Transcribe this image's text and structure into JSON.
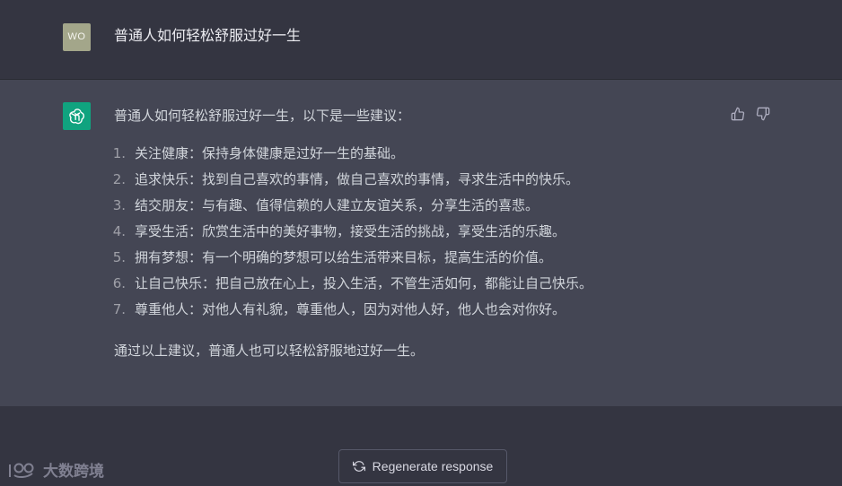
{
  "user_message": {
    "avatar_initials": "WO",
    "text": "普通人如何轻松舒服过好一生"
  },
  "assistant_message": {
    "intro": "普通人如何轻松舒服过好一生，以下是一些建议：",
    "items": [
      {
        "num": "1.",
        "text": "关注健康：保持身体健康是过好一生的基础。"
      },
      {
        "num": "2.",
        "text": "追求快乐：找到自己喜欢的事情，做自己喜欢的事情，寻求生活中的快乐。"
      },
      {
        "num": "3.",
        "text": "结交朋友：与有趣、值得信赖的人建立友谊关系，分享生活的喜悲。"
      },
      {
        "num": "4.",
        "text": "享受生活：欣赏生活中的美好事物，接受生活的挑战，享受生活的乐趣。"
      },
      {
        "num": "5.",
        "text": "拥有梦想：有一个明确的梦想可以给生活带来目标，提高生活的价值。"
      },
      {
        "num": "6.",
        "text": "让自己快乐：把自己放在心上，投入生活，不管生活如何，都能让自己快乐。"
      },
      {
        "num": "7.",
        "text": "尊重他人：对他人有礼貌，尊重他人，因为对他人好，他人也会对你好。"
      }
    ],
    "outro": "通过以上建议，普通人也可以轻松舒服地过好一生。"
  },
  "feedback": {
    "thumbs_up_icon": "thumbs-up-icon",
    "thumbs_down_icon": "thumbs-down-icon"
  },
  "regenerate": {
    "label": "Regenerate response",
    "icon": "refresh-icon"
  },
  "watermark": {
    "text": "大数跨境"
  },
  "colors": {
    "page_bg": "#343541",
    "assistant_bg": "#444654",
    "assistant_avatar": "#10a37f",
    "user_avatar": "#a3a68a"
  }
}
